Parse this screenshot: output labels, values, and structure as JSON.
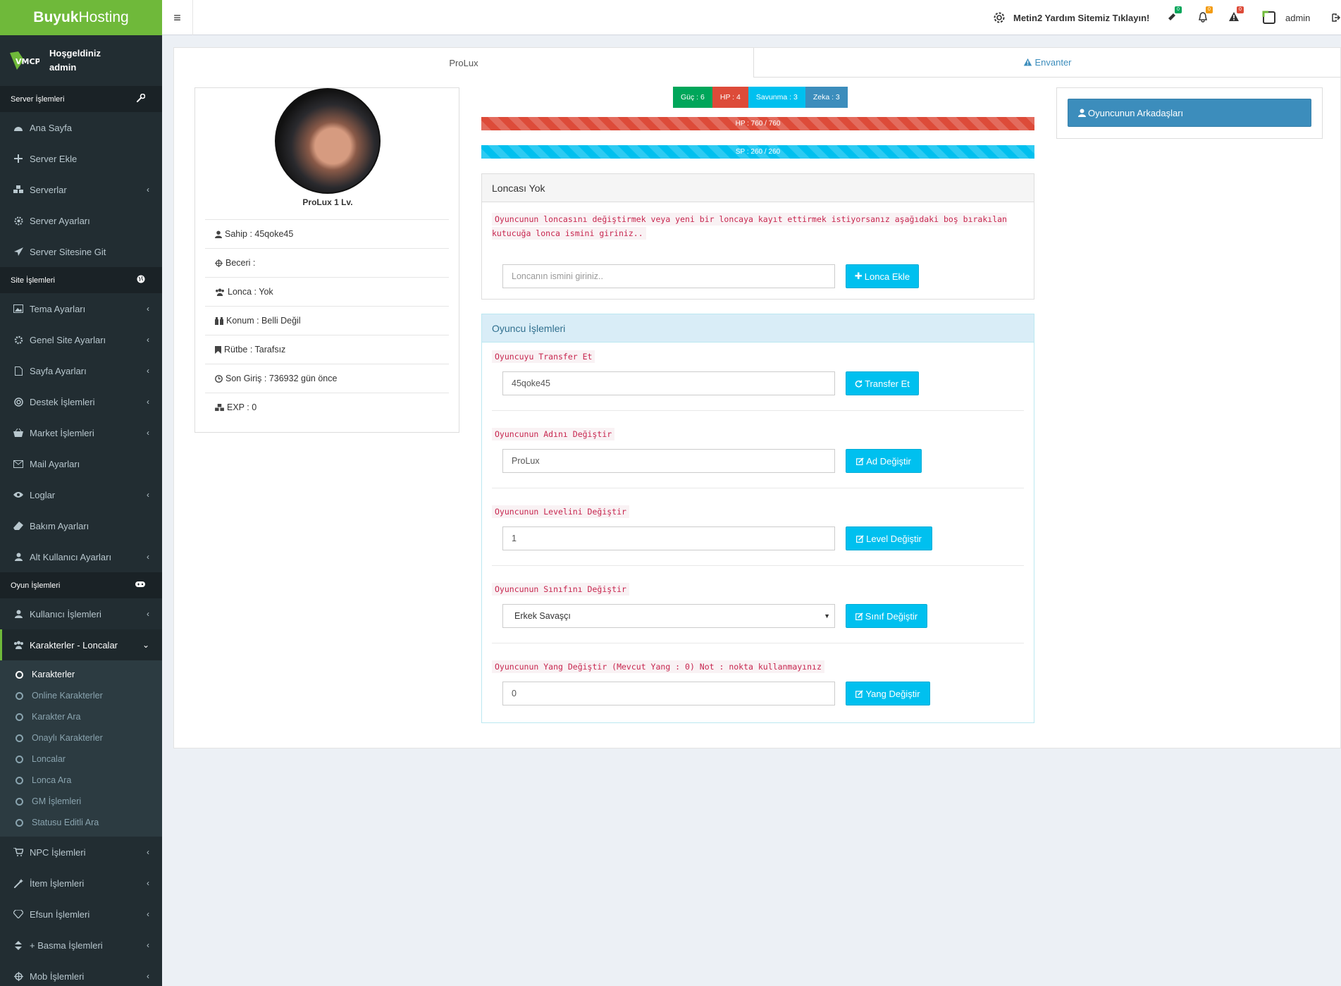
{
  "brand": {
    "bold": "Buyuk",
    "regular": "Hosting"
  },
  "user_panel": {
    "greeting": "Hoşgeldiniz",
    "username": "admin"
  },
  "sidebar": {
    "sections": [
      {
        "title": "Server İşlemleri",
        "icon": "wrench-icon",
        "items": [
          {
            "label": "Ana Sayfa",
            "icon": "dashboard-icon",
            "chevron": false
          },
          {
            "label": "Server Ekle",
            "icon": "plus-icon",
            "chevron": false
          },
          {
            "label": "Serverlar",
            "icon": "cubes-icon",
            "chevron": true
          },
          {
            "label": "Server Ayarları",
            "icon": "gear-icon",
            "chevron": false
          },
          {
            "label": "Server Sitesine Git",
            "icon": "paper-plane-icon",
            "chevron": false
          }
        ]
      },
      {
        "title": "Site İşlemleri",
        "icon": "globe-icon",
        "items": [
          {
            "label": "Tema Ayarları",
            "icon": "image-icon",
            "chevron": true
          },
          {
            "label": "Genel Site Ayarları",
            "icon": "cog-icon",
            "chevron": true
          },
          {
            "label": "Sayfa Ayarları",
            "icon": "file-icon",
            "chevron": true
          },
          {
            "label": "Destek İşlemleri",
            "icon": "lifebuoy-icon",
            "chevron": true
          },
          {
            "label": "Market İşlemleri",
            "icon": "basket-icon",
            "chevron": true
          },
          {
            "label": "Mail Ayarları",
            "icon": "envelope-icon",
            "chevron": false
          },
          {
            "label": "Loglar",
            "icon": "eye-icon",
            "chevron": true
          },
          {
            "label": "Bakım Ayarları",
            "icon": "eraser-icon",
            "chevron": false
          },
          {
            "label": "Alt Kullanıcı Ayarları",
            "icon": "user-icon",
            "chevron": true
          }
        ]
      },
      {
        "title": "Oyun İşlemleri",
        "icon": "gamepad-icon",
        "items": [
          {
            "label": "Kullanıcı İşlemleri",
            "icon": "user-icon",
            "chevron": true
          },
          {
            "label": "Karakterler - Loncalar",
            "icon": "users-icon",
            "chevron": true,
            "active": true,
            "submenu": [
              "Karakterler",
              "Online Karakterler",
              "Karakter Ara",
              "Onaylı Karakterler",
              "Loncalar",
              "Lonca Ara",
              "GM İşlemleri",
              "Statusu Editli Ara"
            ],
            "active_sub": 0
          },
          {
            "label": "NPC İşlemleri",
            "icon": "cart-icon",
            "chevron": true
          },
          {
            "label": "İtem İşlemleri",
            "icon": "magic-icon",
            "chevron": true
          },
          {
            "label": "Efsun İşlemleri",
            "icon": "diamond-icon",
            "chevron": true
          },
          {
            "label": "+ Basma İşlemleri",
            "icon": "sort-icon",
            "chevron": true
          },
          {
            "label": "Mob İşlemleri",
            "icon": "crosshair-icon",
            "chevron": true
          }
        ]
      }
    ]
  },
  "header": {
    "help_link": "Metin2 Yardım Sitemiz Tıklayın!",
    "badges": [
      {
        "icon": "ticket-icon",
        "count": "0",
        "color": "#00a65a"
      },
      {
        "icon": "bell-icon",
        "count": "0",
        "color": "#f39c12"
      },
      {
        "icon": "warning-icon",
        "count": "0",
        "color": "#dd4b39"
      }
    ],
    "admin": "admin"
  },
  "tabs": [
    {
      "label": "ProLux",
      "active": true
    },
    {
      "label": "Envanter",
      "active": false,
      "icon": "warning-icon"
    }
  ],
  "profile": {
    "name_line": "ProLux 1 Lv.",
    "rows": [
      {
        "icon": "user-icon",
        "text": "Sahip : 45qoke45"
      },
      {
        "icon": "crosshair-icon",
        "text": "Beceri :"
      },
      {
        "icon": "users-icon",
        "text": "Lonca : Yok"
      },
      {
        "icon": "binoculars-icon",
        "text": "Konum : Belli Değil"
      },
      {
        "icon": "bookmark-icon",
        "text": "Rütbe : Tarafsız"
      },
      {
        "icon": "clock-icon",
        "text": "Son Giriş : 736932 gün önce"
      },
      {
        "icon": "cubes-icon",
        "text": "EXP : 0"
      }
    ]
  },
  "stats": [
    {
      "label": "Güç : 6",
      "color": "#00a65a"
    },
    {
      "label": "HP : 4",
      "color": "#dd4b39"
    },
    {
      "label": "Savunma : 3",
      "color": "#00c0ef"
    },
    {
      "label": "Zeka : 3",
      "color": "#3c8dbc"
    }
  ],
  "bars": {
    "hp": {
      "label": "HP : 760 / 760",
      "fraction": 1.0
    },
    "sp": {
      "label": "SP : 260 / 260",
      "fraction": 1.0
    }
  },
  "guild": {
    "title": "Loncası Yok",
    "note": "Oyuncunun loncasını değiştirmek veya yeni bir loncaya kayıt ettirmek istiyorsanız aşağıdaki boş bırakılan kutucuğa lonca ismini giriniz..",
    "input_placeholder": "Loncanın ismini giriniz..",
    "button": "Lonca Ekle"
  },
  "ops": {
    "title": "Oyuncu İşlemleri",
    "forms": [
      {
        "label": "Oyuncuyu Transfer Et",
        "value": "45qoke45",
        "button": "Transfer Et",
        "btn_icon": "refresh-icon",
        "type": "input"
      },
      {
        "label": "Oyuncunun Adını Değiştir",
        "value": "ProLux",
        "button": "Ad Değiştir",
        "btn_icon": "edit-icon",
        "type": "input"
      },
      {
        "label": "Oyuncunun Levelini Değiştir",
        "value": "1",
        "button": "Level Değiştir",
        "btn_icon": "edit-icon",
        "type": "input"
      },
      {
        "label": "Oyuncunun Sınıfını Değiştir",
        "value": "Erkek Savaşçı",
        "button": "Sınıf Değiştir",
        "btn_icon": "edit-icon",
        "type": "select"
      },
      {
        "label": "Oyuncunun Yang Değiştir (Mevcut Yang : 0) Not : nokta kullanmayınız",
        "value": "0",
        "button": "Yang Değiştir",
        "btn_icon": "edit-icon",
        "type": "input"
      }
    ]
  },
  "friends_button": "Oyuncunun Arkadaşları",
  "colors": {
    "brand_green": "#6fb93a",
    "sidebar": "#222d32",
    "primary": "#3c8dbc",
    "info": "#00c0ef",
    "danger": "#dd4b39",
    "success": "#00a65a"
  }
}
